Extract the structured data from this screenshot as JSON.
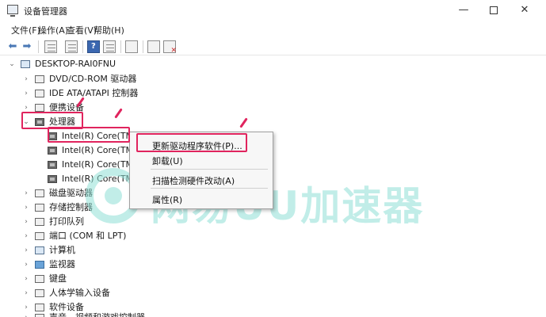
{
  "window": {
    "title": "设备管理器",
    "controls": {
      "minimize": "—",
      "close": "✕"
    }
  },
  "menu": [
    "文件(F)",
    "操作(A)",
    "查看(V)",
    "帮助(H)"
  ],
  "tree": {
    "root": "DESKTOP-RAI0FNU",
    "nodes": [
      {
        "label": "DVD/CD-ROM 驱动器",
        "icon": "dvd-icon"
      },
      {
        "label": "IDE ATA/ATAPI 控制器",
        "icon": "ide-icon"
      },
      {
        "label": "便携设备",
        "icon": "portable-device-icon"
      },
      {
        "label": "处理器",
        "icon": "processor-icon",
        "expanded": true,
        "children": [
          "Intel(R) Core(TM",
          "Intel(R) Core(TM",
          "Intel(R) Core(TM",
          "Intel(R) Core(TM"
        ]
      },
      {
        "label": "磁盘驱动器",
        "icon": "disk-icon"
      },
      {
        "label": "存储控制器",
        "icon": "storage-icon"
      },
      {
        "label": "打印队列",
        "icon": "printer-icon"
      },
      {
        "label": "端口 (COM 和 LPT)",
        "icon": "port-icon"
      },
      {
        "label": "计算机",
        "icon": "computer-icon"
      },
      {
        "label": "监视器",
        "icon": "monitor-icon"
      },
      {
        "label": "键盘",
        "icon": "keyboard-icon"
      },
      {
        "label": "人体学输入设备",
        "icon": "hid-icon"
      },
      {
        "label": "软件设备",
        "icon": "software-device-icon"
      },
      {
        "label": "声音、视频和游戏控制器",
        "icon": "sound-icon"
      }
    ]
  },
  "context_menu": {
    "items": [
      "更新驱动程序软件(P)...",
      "卸载(U)",
      "扫描检测硬件改动(A)",
      "属性(R)"
    ]
  },
  "watermark": "网易UU加速器",
  "colors": {
    "highlight": "#e0245e",
    "watermark": "#8fe0d6"
  }
}
